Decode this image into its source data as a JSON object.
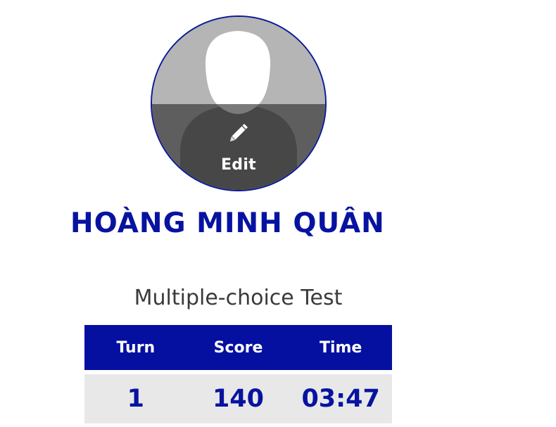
{
  "profile": {
    "edit_label": "Edit",
    "name": "HOÀNG MINH QUÂN"
  },
  "test": {
    "title": "Multiple-choice Test",
    "columns": [
      "Turn",
      "Score",
      "Time"
    ],
    "rows": [
      [
        "1",
        "140",
        "03:47"
      ]
    ]
  },
  "colors": {
    "brand_blue": "#0510a0",
    "row_bg": "#e8e8e8",
    "avatar_bg": "#b5b5b5"
  },
  "icons": {
    "edit": "pencil-icon",
    "avatar": "user-silhouette-icon"
  }
}
